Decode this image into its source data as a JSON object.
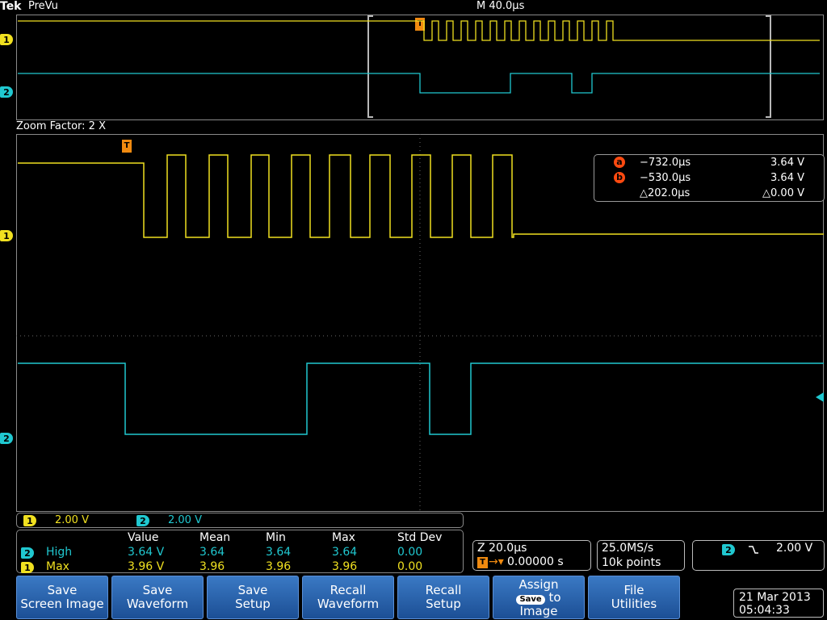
{
  "header": {
    "brand": "Tek",
    "mode": "PreVu",
    "timebase": "M 40.0µs"
  },
  "zoom": {
    "label": "Zoom Factor: 2 X"
  },
  "channels": [
    {
      "id": "1",
      "color": "#f0e020",
      "scale": "2.00 V"
    },
    {
      "id": "2",
      "color": "#20c8d0",
      "scale": "2.00 V"
    }
  ],
  "trigger_marker": "T",
  "cursors": {
    "a": {
      "label": "a",
      "time": "−732.0µs",
      "volt": "3.64 V"
    },
    "b": {
      "label": "b",
      "time": "−530.0µs",
      "volt": "3.64 V"
    },
    "delta": {
      "time": "△202.0µs",
      "volt": "△0.00 V"
    }
  },
  "measurements": {
    "headers": [
      "Value",
      "Mean",
      "Min",
      "Max",
      "Std Dev"
    ],
    "rows": [
      {
        "channel": "2",
        "name": "High",
        "value": "3.64 V",
        "mean": "3.64",
        "min": "3.64",
        "max": "3.64",
        "std": "0.00"
      },
      {
        "channel": "1",
        "name": "Max",
        "value": "3.96 V",
        "mean": "3.96",
        "min": "3.96",
        "max": "3.96",
        "std": "0.00"
      }
    ]
  },
  "zoom_info": {
    "zoom_time": "Z 20.0µs",
    "trigger_pos": "0.00000 s"
  },
  "acquisition": {
    "rate": "25.0MS/s",
    "points": "10k points"
  },
  "trigger": {
    "channel": "2",
    "slope_icon": "falling-edge",
    "level": "2.00 V"
  },
  "buttons": [
    {
      "l1": "Save",
      "l2": "Screen Image"
    },
    {
      "l1": "Save",
      "l2": "Waveform"
    },
    {
      "l1": "Save",
      "l2": "Setup"
    },
    {
      "l1": "Recall",
      "l2": "Waveform"
    },
    {
      "l1": "Recall",
      "l2": "Setup"
    },
    {
      "l1": "Assign",
      "chip": "Save",
      "l2": "to",
      "l3": "Image"
    },
    {
      "l1": "File",
      "l2": "Utilities"
    }
  ],
  "datetime": {
    "date": "21 Mar 2013",
    "time": "05:04:33"
  }
}
